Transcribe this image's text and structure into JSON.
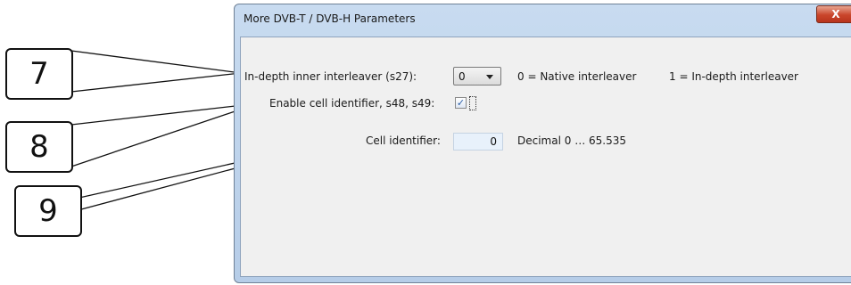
{
  "callouts": [
    {
      "number": "7"
    },
    {
      "number": "8"
    },
    {
      "number": "9"
    }
  ],
  "window": {
    "title": "More DVB-T / DVB-H Parameters",
    "close_label": "X"
  },
  "rows": {
    "interleaver": {
      "label": "In-depth inner interleaver (s27):",
      "selected": "0",
      "hint_0": "0 = Native interleaver",
      "hint_1": "1 = In-depth interleaver"
    },
    "cell_id_enable": {
      "label": "Enable cell identifier, s48, s49:",
      "checked": true,
      "check_glyph": "✓"
    },
    "cell_id": {
      "label": "Cell identifier:",
      "value": "0",
      "range_hint": "Decimal 0 … 65.535"
    }
  }
}
